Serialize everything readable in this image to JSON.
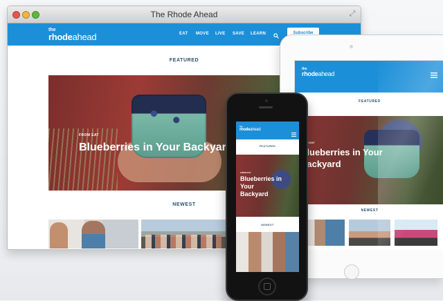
{
  "window": {
    "title": "The Rhode Ahead"
  },
  "brand": {
    "top": "the",
    "main_a": "rhode",
    "main_b": "ahead"
  },
  "nav": {
    "items": [
      "EAT",
      "MOVE",
      "LIVE",
      "SAVE",
      "LEARN"
    ],
    "subscribe": "Subscribe"
  },
  "featured": {
    "label": "FEATURED",
    "kicker": "FROM EAT",
    "title": "Blueberries in Your Backyard"
  },
  "newest": {
    "label": "NEWEST"
  },
  "colors": {
    "brand_blue": "#1c8fd9"
  }
}
